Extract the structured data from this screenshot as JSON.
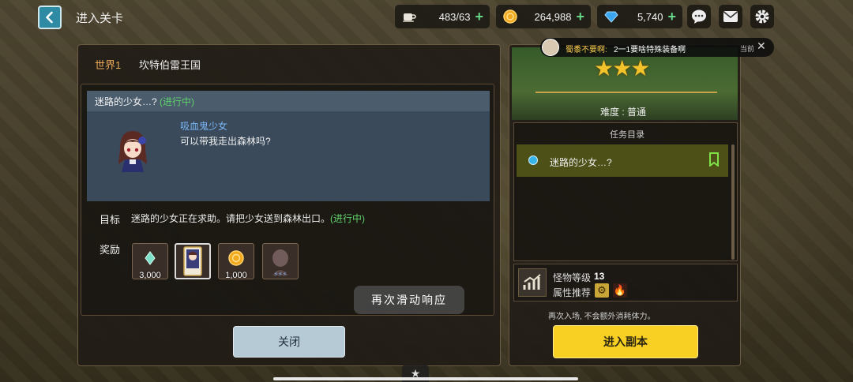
{
  "header": {
    "title": "进入关卡",
    "stamina": "483/63",
    "gold": "264,988",
    "gems": "5,740"
  },
  "stage": {
    "world_label": "世界1",
    "world_name": "坎特伯雷王国"
  },
  "story": {
    "title": "迷路的少女…?",
    "status": "(进行中)",
    "speaker": "吸血鬼少女",
    "dialog": "可以带我走出森林吗?"
  },
  "goal": {
    "label": "目标",
    "text": "迷路的少女正在求助。请把少女送到森林出口。",
    "status": "(进行中)"
  },
  "rewards": {
    "label": "奖励",
    "items": [
      {
        "icon": "gem-icon",
        "qty": "3,000"
      },
      {
        "icon": "character-card-icon",
        "qty": ""
      },
      {
        "icon": "gold-coin-icon",
        "qty": "1,000"
      },
      {
        "icon": "hero-piece-icon",
        "qty": ""
      }
    ]
  },
  "close_label": "关闭",
  "toast": "再次滑动响应",
  "right": {
    "stars": "★★★",
    "difficulty": "难度 : 普通",
    "mission_header": "任务目录",
    "mission_item": "迷路的少女…?",
    "monster_level_label": "怪物等级",
    "monster_level": "13",
    "attr_label": "属性推荐",
    "note": "再次入场, 不会额外消耗体力。",
    "enter_label": "进入副本"
  },
  "notification": {
    "user": "蜀黍不要啊:",
    "message": "2一1要啥特殊装备啊",
    "time": "当前"
  },
  "colors": {
    "accent_yellow": "#f7d023",
    "progress_green": "#5fd36b",
    "world_orange": "#e8a85a",
    "speaker_blue": "#7ab6f5"
  }
}
